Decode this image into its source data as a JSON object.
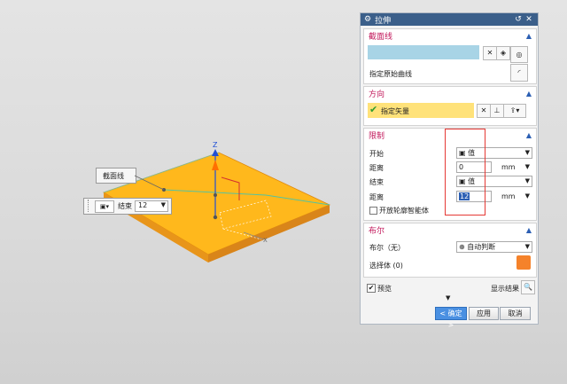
{
  "viewport": {
    "callout_section": "截面线",
    "callout_end_label": "结束",
    "callout_end_value": "12",
    "axis_z": "Z",
    "axis_x": "X"
  },
  "dialog": {
    "title": "拉伸",
    "section": {
      "header": "截面线",
      "select_curve_label": "指定原始曲线"
    },
    "direction": {
      "header": "方向",
      "vector_label": "指定矢量"
    },
    "limits": {
      "header": "限制",
      "start_label": "开始",
      "start_mode": "值",
      "start_distance_label": "距离",
      "start_distance_value": "0",
      "start_unit": "mm",
      "end_label": "结束",
      "end_mode": "值",
      "end_distance_label": "距离",
      "end_distance_value": "12",
      "end_unit": "mm",
      "open_profile_label": "开放轮廓智能体"
    },
    "boolean": {
      "header": "布尔",
      "boolean_label": "布尔（无）",
      "boolean_value": "自动判断",
      "select_body_label": "选择体 (0)"
    },
    "preview_label": "预览",
    "show_result_label": "显示结果",
    "ok_label": "< 确定 >",
    "apply_label": "应用",
    "cancel_label": "取消"
  },
  "colors": {
    "plate_top": "#FFB81C",
    "plate_side": "#E8951A",
    "title_bar": "#3B5F8A",
    "section_header": "#C2185B",
    "highlight_vector": "#FFE27A",
    "selection_field": "#A8D4E6",
    "red_box": "#E53935",
    "ok_button": "#4A90E2"
  }
}
